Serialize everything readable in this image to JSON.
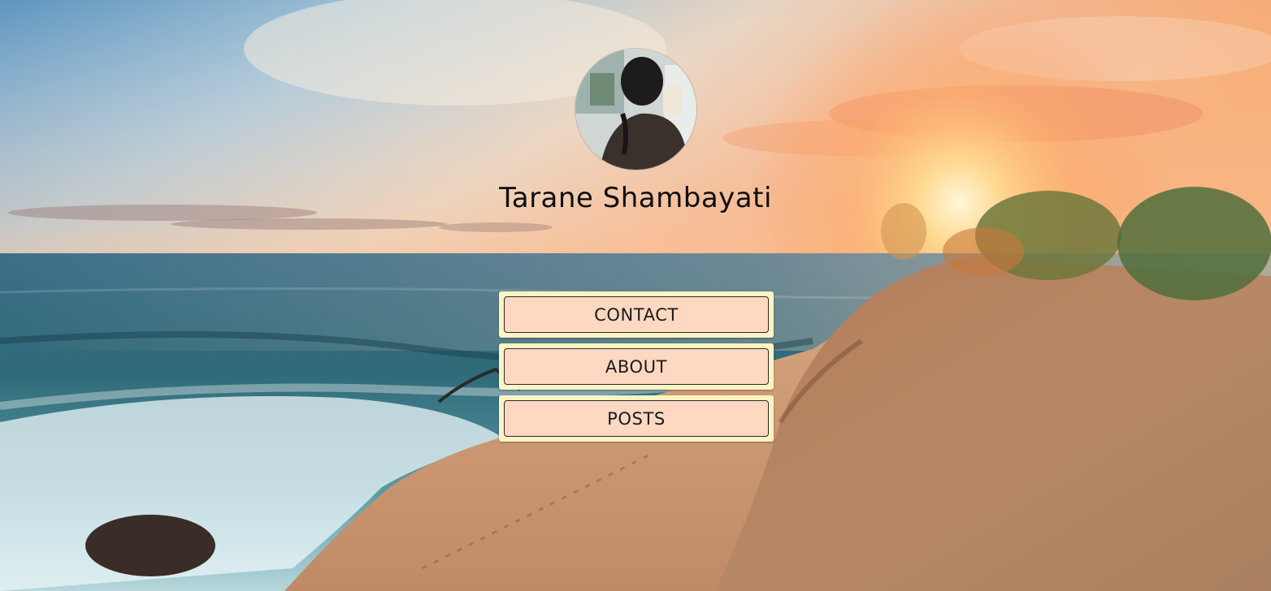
{
  "profile": {
    "name": "Tarane Shambayati"
  },
  "nav": {
    "items": [
      {
        "label": "CONTACT"
      },
      {
        "label": "ABOUT"
      },
      {
        "label": "POSTS"
      }
    ]
  },
  "theme": {
    "button_outer": "#fff3c2",
    "button_inner": "#ffd8c2",
    "button_border": "#2a2a2a",
    "name_color": "#0d0d0d"
  }
}
